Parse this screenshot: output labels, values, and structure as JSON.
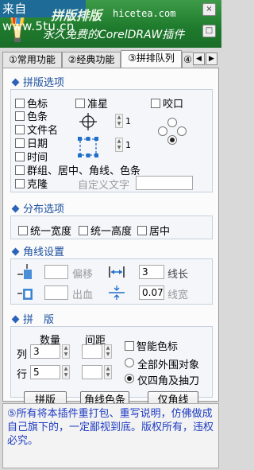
{
  "watermark": "来自 www.5tu.cn",
  "title": {
    "product": "拼版排版",
    "site": "hicetea.com",
    "subtitle": "永久免费的CorelDRAW插件"
  },
  "window_buttons": {
    "close": "×",
    "pin": "□"
  },
  "tabs": [
    {
      "label": "①常用功能"
    },
    {
      "label": "②经典功能"
    },
    {
      "label": "③拼排队列"
    },
    {
      "label": "④"
    }
  ],
  "tab_scroll": {
    "left": "◀",
    "right": "▶"
  },
  "layout_options": {
    "heading": "拼版选项",
    "checks": {
      "color_mark": "色标",
      "crop_mark": "准星",
      "bite": "咬口",
      "color_bar": "色条",
      "filename": "文件名",
      "date": "日期",
      "time": "时间",
      "group_etc": "群组、居中、角线、色条",
      "clone": "克隆"
    },
    "crop_count": "1",
    "bar_count": "1",
    "custom_text_label": "自定义文字",
    "custom_text_value": ""
  },
  "distribution": {
    "heading": "分布选项",
    "uniform_width": "统一宽度",
    "uniform_height": "统一高度",
    "center": "居中"
  },
  "corner_lines": {
    "heading": "角线设置",
    "offset_label": "偏移",
    "offset_value": "",
    "bleed_label": "出血",
    "bleed_value": "",
    "line_length_label": "线长",
    "line_length_value": "3",
    "line_width_label": "线宽",
    "line_width_value": "0.07"
  },
  "imposition": {
    "heading": "拼　版",
    "qty_header": "数量",
    "spacing_header": "间距",
    "col_label": "列",
    "row_label": "行",
    "cols": "3",
    "rows": "5",
    "col_spacing": "",
    "row_spacing": "",
    "smart_color_mark": "智能色标",
    "all_outer": "全部外围对象",
    "only_four_corners": "仅四角及抽刀",
    "btn_impose": "拼版",
    "btn_corner_colorbar": "角线色条",
    "btn_corner_only": "仅角线"
  },
  "footer": "⑤所有将本插件重打包、重写说明，仿佛做成自己旗下的，一定鄙视到底。版权所有，违权必究。",
  "colors": {
    "title_green": "#1e7a2c",
    "watermark_blue": "#1d6b96",
    "heading_blue": "#1a4fa0",
    "footer_text": "#1f3cc2"
  }
}
